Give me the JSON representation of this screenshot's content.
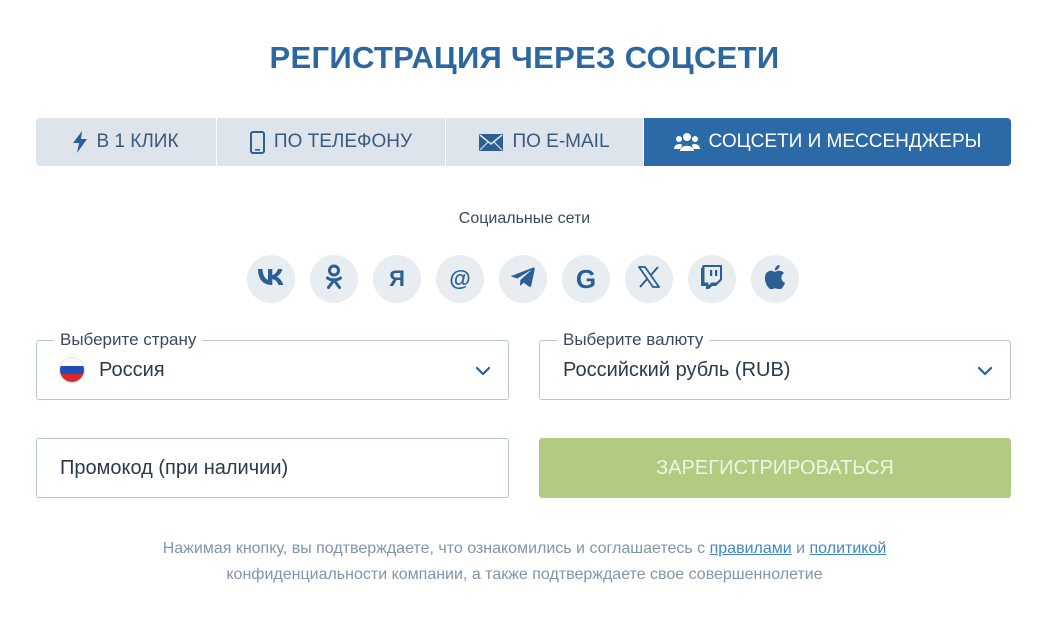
{
  "title": "РЕГИСТРАЦИЯ ЧЕРЕЗ СОЦСЕТИ",
  "tabs": [
    {
      "label": "В 1 КЛИК",
      "icon": "lightning-icon",
      "active": false
    },
    {
      "label": "ПО ТЕЛЕФОНУ",
      "icon": "phone-icon",
      "active": false
    },
    {
      "label": "ПО E-MAIL",
      "icon": "envelope-icon",
      "active": false
    },
    {
      "label": "СОЦСЕТИ И МЕССЕНДЖЕРЫ",
      "icon": "users-icon",
      "active": true
    }
  ],
  "social": {
    "label": "Социальные сети",
    "networks": [
      {
        "name": "vk",
        "glyph": "vk",
        "icon": "vk-icon"
      },
      {
        "name": "odnoklassniki",
        "glyph": "ok",
        "icon": "odnoklassniki-icon"
      },
      {
        "name": "yandex",
        "glyph": "Я",
        "icon": "yandex-icon"
      },
      {
        "name": "mail",
        "glyph": "@",
        "icon": "mail-ru-icon"
      },
      {
        "name": "telegram",
        "glyph": "",
        "icon": "telegram-icon"
      },
      {
        "name": "google",
        "glyph": "G",
        "icon": "google-icon"
      },
      {
        "name": "x",
        "glyph": "X",
        "icon": "x-icon"
      },
      {
        "name": "twitch",
        "glyph": "",
        "icon": "twitch-icon"
      },
      {
        "name": "apple",
        "glyph": "",
        "icon": "apple-icon"
      }
    ]
  },
  "country": {
    "legend": "Выберите страну",
    "value": "Россия"
  },
  "currency": {
    "legend": "Выберите валюту",
    "value": "Российский рубль (RUB)"
  },
  "promo": {
    "placeholder": "Промокод (при наличии)"
  },
  "register_label": "ЗАРЕГИСТРИРОВАТЬСЯ",
  "disclaimer": {
    "part1": "Нажимая кнопку, вы подтверждаете, что ознакомились и соглашаетесь с ",
    "rules_link": "правилами",
    "and": " и ",
    "policy_link": "политикой",
    "part2": "конфиденциальности компании, а также подтверждаете свое совершеннолетие"
  },
  "colors": {
    "accent": "#2c6aa7",
    "title": "#2d67a0",
    "tab_bg": "#dde4ec",
    "register_disabled": "#b1cb82",
    "link": "#3f87c8"
  }
}
